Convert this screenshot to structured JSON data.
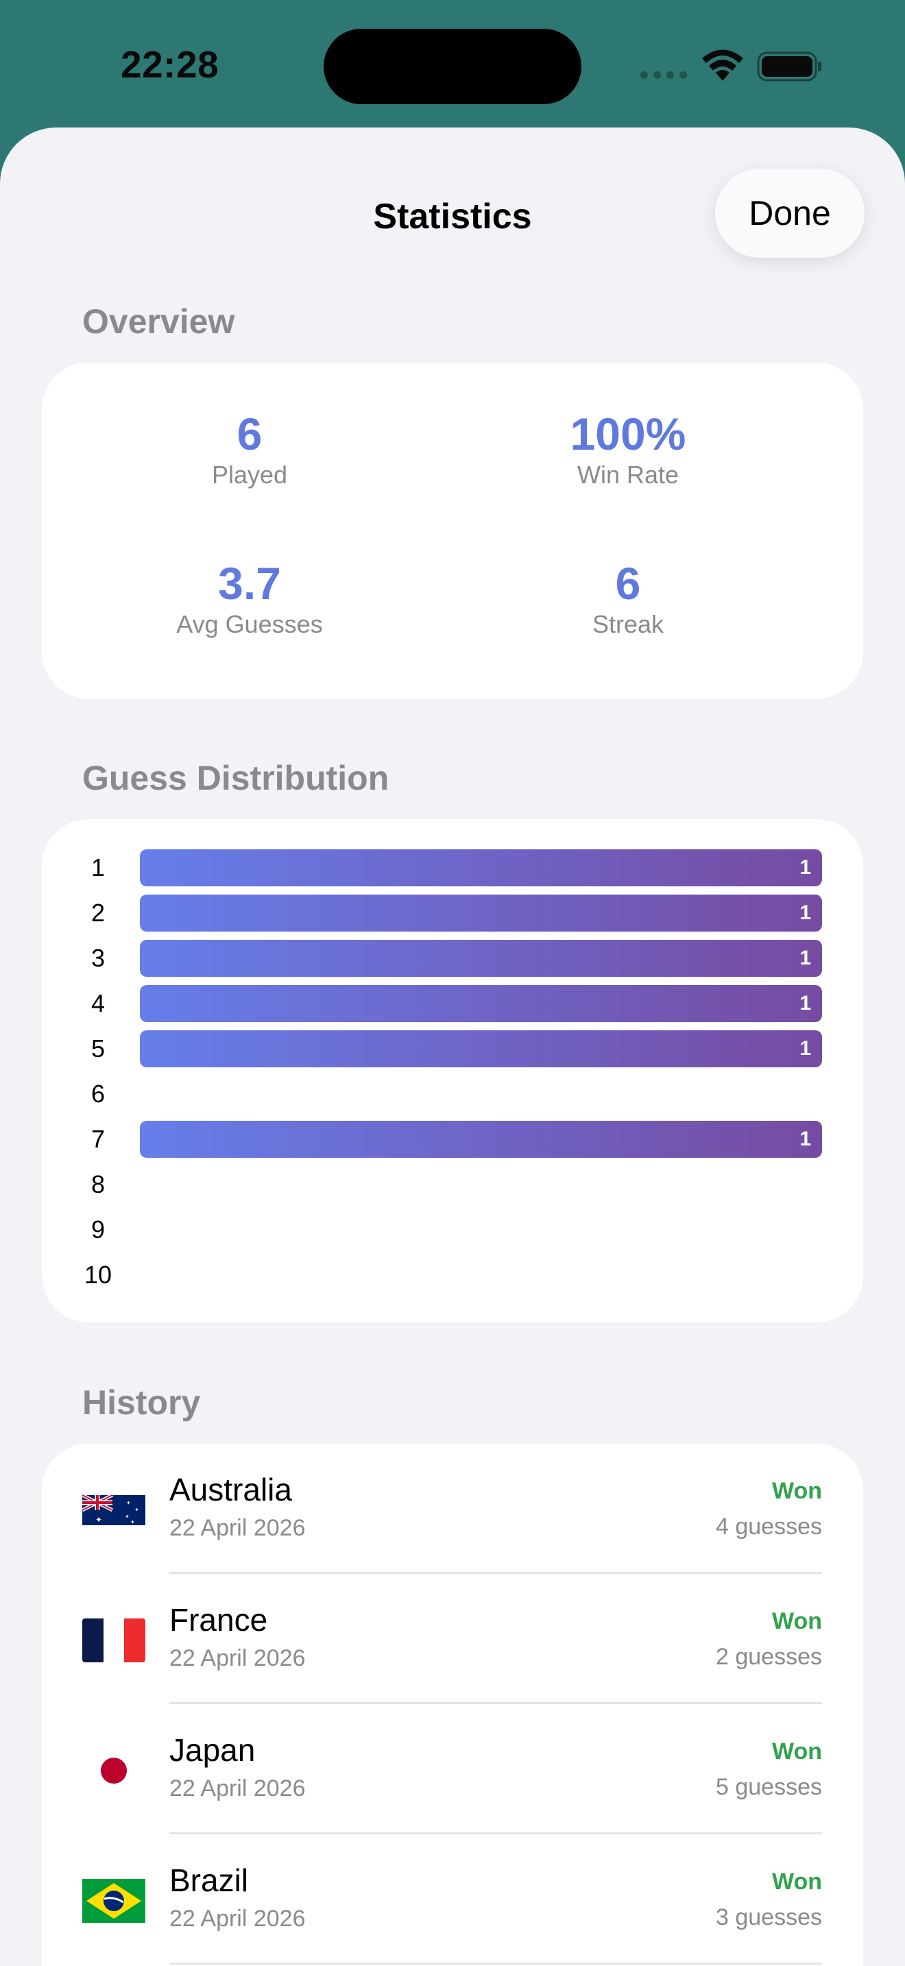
{
  "status_bar": {
    "time": "22:28"
  },
  "sheet": {
    "title": "Statistics",
    "done_label": "Done"
  },
  "overview": {
    "section_title": "Overview",
    "played": {
      "value": "6",
      "label": "Played"
    },
    "win_rate": {
      "value": "100%",
      "label": "Win Rate"
    },
    "avg_guesses": {
      "value": "3.7",
      "label": "Avg Guesses"
    },
    "streak": {
      "value": "6",
      "label": "Streak"
    }
  },
  "distribution": {
    "section_title": "Guess Distribution",
    "rows": [
      {
        "guess": "1",
        "count": 1,
        "count_label": "1"
      },
      {
        "guess": "2",
        "count": 1,
        "count_label": "1"
      },
      {
        "guess": "3",
        "count": 1,
        "count_label": "1"
      },
      {
        "guess": "4",
        "count": 1,
        "count_label": "1"
      },
      {
        "guess": "5",
        "count": 1,
        "count_label": "1"
      },
      {
        "guess": "6",
        "count": 0,
        "count_label": ""
      },
      {
        "guess": "7",
        "count": 1,
        "count_label": "1"
      },
      {
        "guess": "8",
        "count": 0,
        "count_label": ""
      },
      {
        "guess": "9",
        "count": 0,
        "count_label": ""
      },
      {
        "guess": "10",
        "count": 0,
        "count_label": ""
      }
    ],
    "bar_colors": [
      "#667EEA",
      "#764BA2"
    ]
  },
  "history": {
    "section_title": "History",
    "items": [
      {
        "country": "Australia",
        "date": "22 April 2026",
        "status": "Won",
        "guesses": "4 guesses",
        "flag_icon": "australia-flag-icon"
      },
      {
        "country": "France",
        "date": "22 April 2026",
        "status": "Won",
        "guesses": "2 guesses",
        "flag_icon": "france-flag-icon"
      },
      {
        "country": "Japan",
        "date": "22 April 2026",
        "status": "Won",
        "guesses": "5 guesses",
        "flag_icon": "japan-flag-icon"
      },
      {
        "country": "Brazil",
        "date": "22 April 2026",
        "status": "Won",
        "guesses": "3 guesses",
        "flag_icon": "brazil-flag-icon"
      }
    ]
  },
  "colors": {
    "header_bg": "#2D7873",
    "sheet_bg": "#F2F2F7",
    "accent": "#6079DE",
    "won": "#31A24C"
  }
}
